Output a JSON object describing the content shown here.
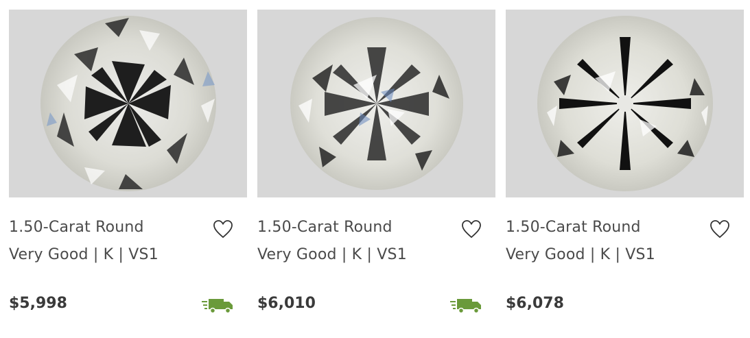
{
  "listings": [
    {
      "title": "1.50-Carat Round",
      "specs": "Very Good | K | VS1",
      "price": "$5,998",
      "shipping_icon": "delivery-truck-icon",
      "favorite_icon": "heart-outline-icon"
    },
    {
      "title": "1.50-Carat Round",
      "specs": "Very Good | K | VS1",
      "price": "$6,010",
      "shipping_icon": "delivery-truck-icon",
      "favorite_icon": "heart-outline-icon"
    },
    {
      "title": "1.50-Carat Round",
      "specs": "Very Good | K | VS1",
      "price": "$6,078",
      "shipping_icon": "none",
      "favorite_icon": "heart-outline-icon"
    }
  ],
  "colors": {
    "truck": "#6a9a3a",
    "image_bg": "#d7d7d7",
    "text": "#4a4a4a"
  }
}
